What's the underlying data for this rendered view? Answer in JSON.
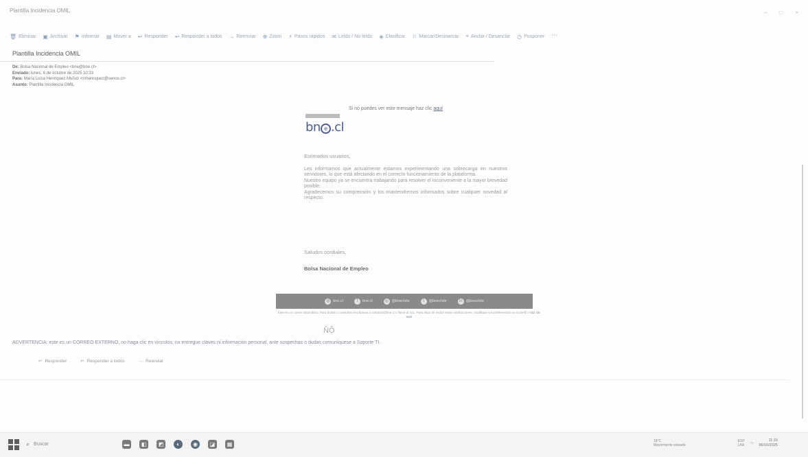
{
  "window": {
    "title": "Plantilla Incidencia OMIL",
    "controls": [
      "–",
      "□",
      "×"
    ]
  },
  "toolbar": {
    "items": [
      {
        "icon": "trash-icon",
        "glyph": "🗑",
        "label": "Eliminar"
      },
      {
        "icon": "archive-icon",
        "glyph": "▣",
        "label": "Archivar"
      },
      {
        "icon": "report-icon",
        "glyph": "⚑",
        "label": "Informar"
      },
      {
        "icon": "move-icon",
        "glyph": "▤",
        "label": "Mover a"
      },
      {
        "icon": "reply-icon",
        "glyph": "↩",
        "label": "Responder"
      },
      {
        "icon": "reply-all-icon",
        "glyph": "↩",
        "label": "Responder a todos"
      },
      {
        "icon": "forward-icon",
        "glyph": "→",
        "label": "Reenviar"
      },
      {
        "icon": "zoom-icon",
        "glyph": "⊕",
        "label": "Zoom"
      },
      {
        "icon": "quick-steps-icon",
        "glyph": "⚡",
        "label": "Pasos rápidos"
      },
      {
        "icon": "read-unread-icon",
        "glyph": "✉",
        "label": "Leído / No leído"
      },
      {
        "icon": "classify-icon",
        "glyph": "◈",
        "label": "Clasificar"
      },
      {
        "icon": "flag-icon",
        "glyph": "⚐",
        "label": "Marcar/Desmarcar"
      },
      {
        "icon": "pin-icon",
        "glyph": "⌖",
        "label": "Anclar / Desanclar"
      },
      {
        "icon": "snooze-icon",
        "glyph": "◷",
        "label": "Posponer"
      }
    ],
    "more_glyph": "⋯"
  },
  "message": {
    "subject": "Plantilla Incidencia OMIL",
    "header": {
      "from_label": "De:",
      "from_value": "Bolsa Nacional de Empleo <bne@bne.cl>",
      "sent_label": "Enviado:",
      "sent_value": "lunes, 6 de octubre de 2025 10:33",
      "to_label": "Para:",
      "to_value": "María Luisa Henríquez Muñoz <mhenriquez@sence.cl>",
      "subject_label": "Asunto:",
      "subject_value": "Plantilla Incidencia OMIL"
    }
  },
  "email": {
    "preheader_text": "Si no puedes ver este mensaje haz clic",
    "preheader_link": "aquí",
    "logo_text_pre": "bn",
    "logo_at": "e",
    "logo_text_post": ".cl",
    "greeting": "Estimados usuarios,",
    "paragraph_1": "Les informamos que actualmente estamos experimentando una sobrecarga en nuestros servidores, lo que está afectando en el correcto funcionamiento de la plataforma.",
    "paragraph_2": "Nuestro equipo ya se encuentra trabajando para resolver el inconveniente a la mayor brevedad posible.",
    "paragraph_3": "Agradecemos su comprensión y los mantendremos informados sobre cualquier novedad al respecto.",
    "closing": "Saludos cordiales,",
    "signature": "Bolsa Nacional de Empleo",
    "social": [
      {
        "icon": "web-icon",
        "glyph": "◍",
        "label": "bne.cl"
      },
      {
        "icon": "facebook-icon",
        "glyph": "f",
        "label": "bne.cl"
      },
      {
        "icon": "instagram-icon",
        "glyph": "◎",
        "label": "@bnechile"
      },
      {
        "icon": "twitter-icon",
        "glyph": "t",
        "label": "@bnechile"
      },
      {
        "icon": "linkedin-icon",
        "glyph": "in",
        "label": "@bnechile"
      }
    ],
    "fine_print": "Este es un correo automático. Para dudas o consultas escríbanos a contacto@bne.cl o llame al 101. Para dejar de recibir estas notificaciones, modifique sus preferencias en su perfil o",
    "fine_print_link": "haz clic aquí"
  },
  "warning_text": "ADVERTENCIA: este es un CORREO EXTERNO, no haga clic en vínculos, no entregue claves ni información personal, ante sospechas o dudas comuníquese a Soporte TI.",
  "reply_actions": [
    {
      "icon": "reply-icon",
      "glyph": "↩",
      "label": "Responder"
    },
    {
      "icon": "reply-all-icon",
      "glyph": "↩",
      "label": "Responder a todos"
    },
    {
      "icon": "forward-icon",
      "glyph": "→",
      "label": "Reenviar"
    }
  ],
  "taskbar": {
    "search_placeholder": "Buscar",
    "apps": [
      {
        "name": "file-explorer-icon",
        "glyph": "▬"
      },
      {
        "name": "store-icon",
        "glyph": "◧"
      },
      {
        "name": "outlook-icon",
        "glyph": "◩"
      },
      {
        "name": "edge-icon",
        "glyph": "◐"
      },
      {
        "name": "chrome-icon",
        "glyph": "◉"
      },
      {
        "name": "photos-icon",
        "glyph": "◪"
      },
      {
        "name": "teams-icon",
        "glyph": "▦"
      }
    ],
    "weather_temp": "18°C",
    "weather_desc": "Mayormente soleado",
    "lang_1": "ESP",
    "lang_2": "LAA",
    "time": "11:15",
    "date": "06/10/2025"
  }
}
